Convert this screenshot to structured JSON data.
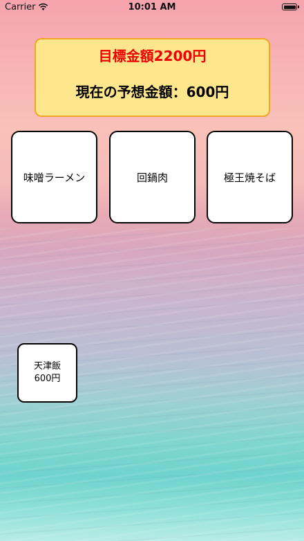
{
  "status_bar": {
    "carrier": "Carrier",
    "time": "10:01 AM",
    "wifi_icon": "wifi-icon",
    "battery_icon": "battery-full-icon"
  },
  "goal": {
    "target_text": "目標金額2200円",
    "current_text": "現在の予想金額：600円",
    "target_color": "#f00000",
    "box_color": "#fde68b",
    "border_color": "#f0a42b"
  },
  "menu": {
    "items": [
      {
        "label": "味噌ラーメン"
      },
      {
        "label": "回鍋肉"
      },
      {
        "label": "極王焼そば"
      }
    ]
  },
  "selected": {
    "name": "天津飯",
    "price": "600円"
  }
}
